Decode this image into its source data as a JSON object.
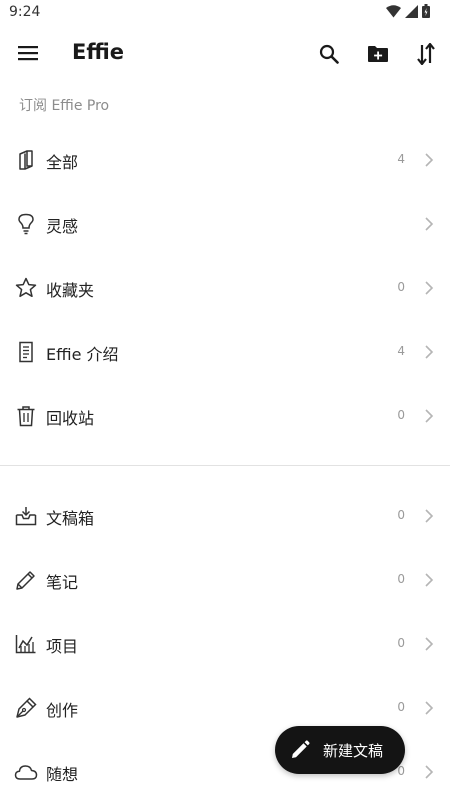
{
  "status_bar": {
    "time": "9:24"
  },
  "header": {
    "title": "Effie",
    "icons": [
      "menu-icon",
      "search-icon",
      "new-folder-icon",
      "sort-icon"
    ]
  },
  "subscribe_text": "订阅 Effie Pro",
  "groups": [
    {
      "items": [
        {
          "label": "全部",
          "count": "4",
          "icon": "book-icon"
        },
        {
          "label": "灵感",
          "count": "",
          "icon": "lightbulb-icon"
        },
        {
          "label": "收藏夹",
          "count": "0",
          "icon": "star-icon"
        },
        {
          "label": "Effie 介绍",
          "count": "4",
          "icon": "document-icon"
        },
        {
          "label": "回收站",
          "count": "0",
          "icon": "trash-icon"
        }
      ]
    },
    {
      "items": [
        {
          "label": "文稿箱",
          "count": "0",
          "icon": "inbox-icon"
        },
        {
          "label": "笔记",
          "count": "0",
          "icon": "pencil-icon"
        },
        {
          "label": "项目",
          "count": "0",
          "icon": "chart-icon"
        },
        {
          "label": "创作",
          "count": "0",
          "icon": "pen-nib-icon"
        },
        {
          "label": "随想",
          "count": "0",
          "icon": "cloud-icon"
        }
      ]
    }
  ],
  "fab": {
    "label": "新建文稿",
    "icon": "edit-icon"
  },
  "colors": {
    "text": "#1f1f1f",
    "muted": "#9a9a9a",
    "fab_bg": "#141414",
    "divider": "#e2e2e2"
  }
}
